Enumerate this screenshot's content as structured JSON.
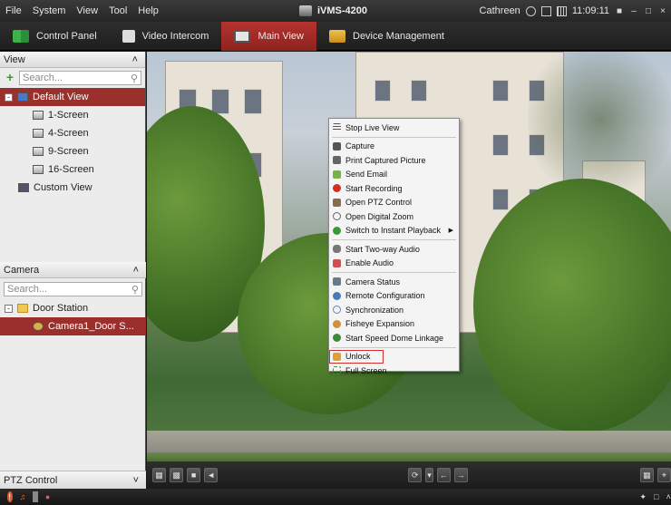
{
  "menubar": {
    "items": [
      "File",
      "System",
      "View",
      "Tool",
      "Help"
    ],
    "app_title": "iVMS-4200",
    "user": "Cathreen",
    "time": "11:09:11"
  },
  "tabs": [
    {
      "label": "Control Panel",
      "icon": "grid-icon"
    },
    {
      "label": "Video Intercom",
      "icon": "intercom-icon"
    },
    {
      "label": "Main View",
      "icon": "monitor-icon",
      "active": true
    },
    {
      "label": "Device Management",
      "icon": "folder-icon"
    }
  ],
  "view_panel": {
    "title": "View",
    "search_placeholder": "Search...",
    "default_view": "Default View",
    "screens": [
      "1-Screen",
      "4-Screen",
      "9-Screen",
      "16-Screen"
    ],
    "custom_view": "Custom View"
  },
  "camera_panel": {
    "title": "Camera",
    "search_placeholder": "Search...",
    "door_station": "Door Station",
    "camera": "Camera1_Door S..."
  },
  "ptz": {
    "title": "PTZ Control"
  },
  "context_menu": {
    "groups": [
      [
        "Stop Live View"
      ],
      [
        "Capture",
        "Print Captured Picture",
        "Send Email",
        "Start Recording",
        "Open PTZ Control",
        "Open Digital Zoom",
        "Switch to Instant Playback"
      ],
      [
        "Start Two-way Audio",
        "Enable Audio"
      ],
      [
        "Camera Status",
        "Remote Configuration",
        "Synchronization",
        "Fisheye Expansion",
        "Start Speed Dome Linkage"
      ],
      [
        "Unlock",
        "Full Screen"
      ]
    ]
  },
  "colors": {
    "accent": "#9b2f2b",
    "tab_active": "#b5332f"
  }
}
